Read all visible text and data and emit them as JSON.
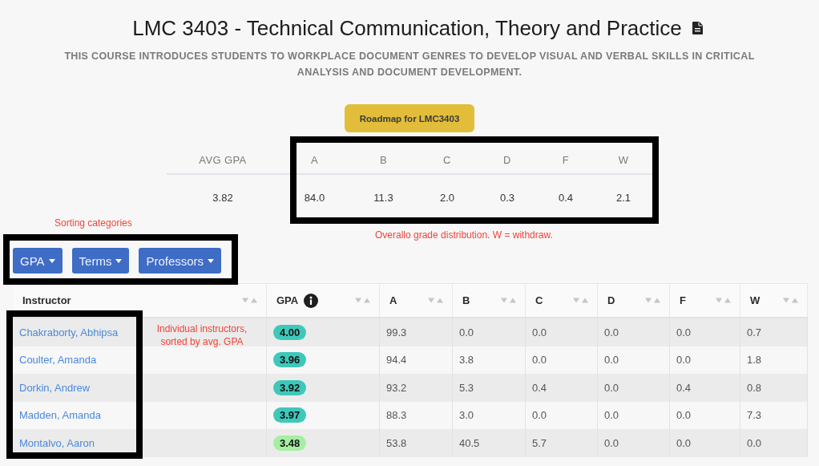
{
  "course": {
    "title": "LMC 3403 - Technical Communication, Theory and Practice",
    "description": "THIS COURSE INTRODUCES STUDENTS TO WORKPLACE DOCUMENT GENRES TO DEVELOP VISUAL AND VERBAL SKILLS IN CRITICAL ANALYSIS AND DOCUMENT DEVELOPMENT."
  },
  "roadmap_button": {
    "label": "Roadmap for LMC3403"
  },
  "summary": {
    "columns": [
      "AVG GPA",
      "A",
      "B",
      "C",
      "D",
      "F",
      "W"
    ],
    "values": [
      "3.82",
      "84.0",
      "11.3",
      "2.0",
      "0.3",
      "0.4",
      "2.1"
    ]
  },
  "sort_buttons": [
    {
      "label": "GPA"
    },
    {
      "label": "Terms"
    },
    {
      "label": "Professors"
    }
  ],
  "table": {
    "columns": [
      {
        "label": "Instructor",
        "info": false
      },
      {
        "label": "GPA",
        "info": true
      },
      {
        "label": "A",
        "info": false
      },
      {
        "label": "B",
        "info": false
      },
      {
        "label": "C",
        "info": false
      },
      {
        "label": "D",
        "info": false
      },
      {
        "label": "F",
        "info": false
      },
      {
        "label": "W",
        "info": false
      }
    ],
    "rows": [
      {
        "instructor": "Chakraborty, Abhipsa",
        "gpa": "4.00",
        "color": "#3ec8ba",
        "grades": [
          "99.3",
          "0.0",
          "0.0",
          "0.0",
          "0.0",
          "0.7"
        ]
      },
      {
        "instructor": "Coulter, Amanda",
        "gpa": "3.96",
        "color": "#3ec8ba",
        "grades": [
          "94.4",
          "3.8",
          "0.0",
          "0.0",
          "0.0",
          "1.8"
        ]
      },
      {
        "instructor": "Dorkin, Andrew",
        "gpa": "3.92",
        "color": "#3ec8ba",
        "grades": [
          "93.2",
          "5.3",
          "0.4",
          "0.0",
          "0.4",
          "0.8"
        ]
      },
      {
        "instructor": "Madden, Amanda",
        "gpa": "3.97",
        "color": "#3ec8ba",
        "grades": [
          "88.3",
          "3.0",
          "0.0",
          "0.0",
          "0.0",
          "7.3"
        ]
      },
      {
        "instructor": "Montalvo, Aaron",
        "gpa": "3.48",
        "color": "#a6eea2",
        "grades": [
          "53.8",
          "40.5",
          "5.7",
          "0.0",
          "0.0",
          "0.0"
        ]
      }
    ]
  },
  "annotations": {
    "sorting_note": "Sorting categories",
    "distribution_note": "Overallo grade distribution. W = withdraw.",
    "instructors_note": "Individual instructors, sorted by avg. GPA"
  }
}
